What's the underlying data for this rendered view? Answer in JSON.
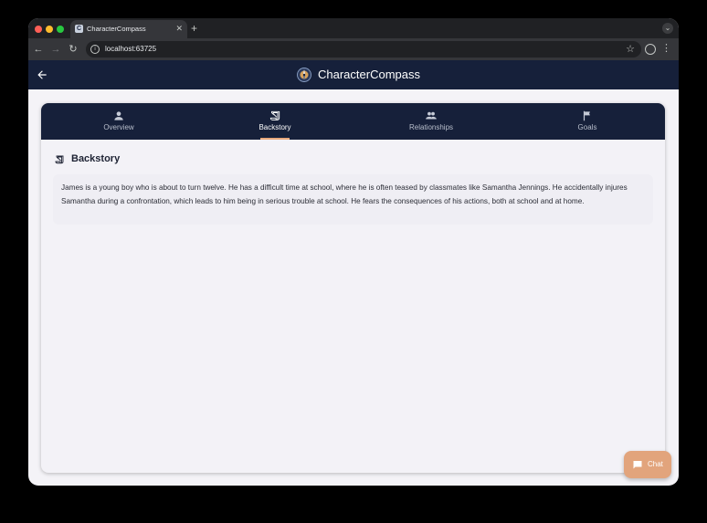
{
  "browser": {
    "tab_title": "CharacterCompass",
    "tab_favicon": "C",
    "new_tab_label": "+",
    "url": "localhost:63725",
    "icons": [
      "back-icon",
      "forward-icon",
      "reload-icon",
      "info-icon",
      "star-icon",
      "profile-icon",
      "menu-icon"
    ]
  },
  "app": {
    "title": "CharacterCompass",
    "header_bg": "#16203a"
  },
  "tabs": [
    {
      "label": "Overview",
      "icon": "person-icon",
      "active": false
    },
    {
      "label": "Backstory",
      "icon": "history-edu-icon",
      "active": true
    },
    {
      "label": "Relationships",
      "icon": "people-icon",
      "active": false
    },
    {
      "label": "Goals",
      "icon": "flag-icon",
      "active": false
    }
  ],
  "section": {
    "title": "Backstory",
    "icon": "history-edu-icon",
    "text": "James is a young boy who is about to turn twelve. He has a difficult time at school, where he is often teased by classmates like Samantha Jennings. He accidentally injures Samantha during a confrontation, which leads to him being in serious trouble at school. He fears the consequences of his actions, both at school and at home."
  },
  "chat": {
    "label": "Chat",
    "icon": "chat-icon",
    "accent": "#e2a47c"
  },
  "colors": {
    "active_indicator": "#e8a87c",
    "background": "#f3f2f7"
  }
}
